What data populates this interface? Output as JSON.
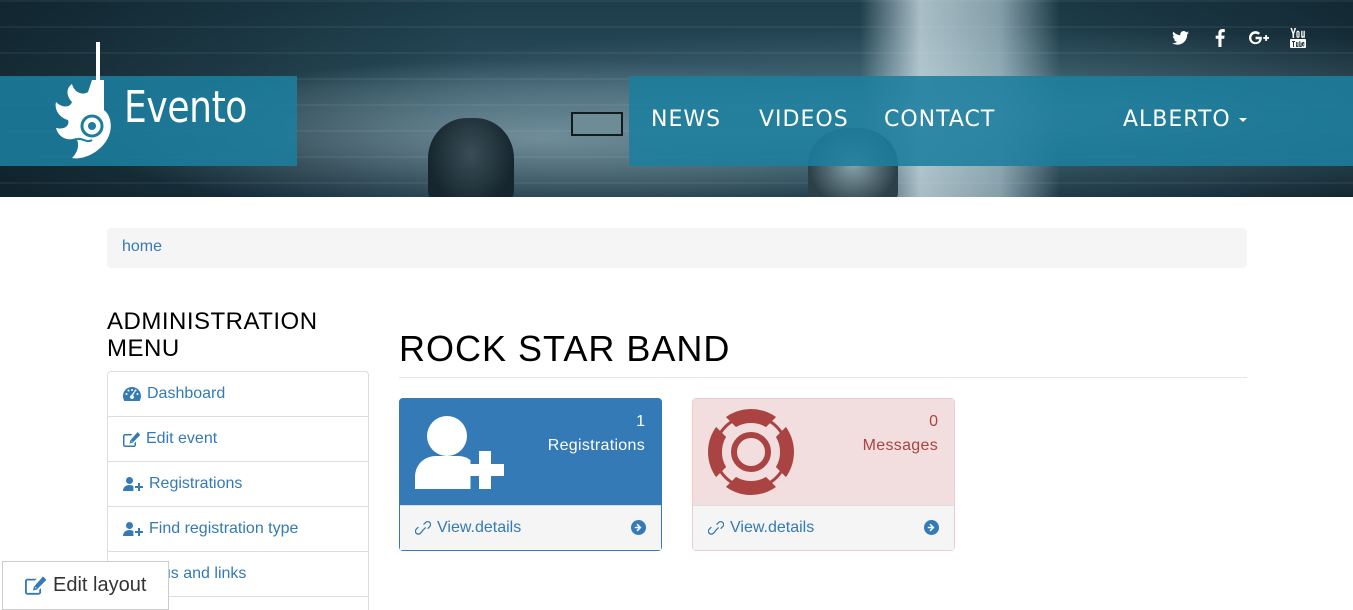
{
  "header": {
    "brand": "Evento",
    "social": [
      "twitter-icon",
      "facebook-icon",
      "google-plus-icon",
      "youtube-icon"
    ],
    "nav": [
      "NEWS",
      "VIDEOS",
      "CONTACT"
    ],
    "user_menu": "ALBERTO",
    "accent_color": "#1b7e9e"
  },
  "breadcrumb": {
    "home": "home"
  },
  "sidebar": {
    "title": "ADMINISTRATION MENU",
    "items": [
      {
        "label": "Dashboard",
        "icon": "dashboard-icon"
      },
      {
        "label": "Edit event",
        "icon": "edit-icon"
      },
      {
        "label": "Registrations",
        "icon": "user-plus-icon"
      },
      {
        "label": "Find registration type",
        "icon": "user-plus-icon"
      },
      {
        "label": "nus and links",
        "icon": ""
      }
    ]
  },
  "main": {
    "title": "ROCK STAR BAND",
    "panels": [
      {
        "count": "1",
        "label": "Registrations",
        "link": "View.details",
        "icon": "user-plus-icon",
        "color": "#337ab7"
      },
      {
        "count": "0",
        "label": "Messages",
        "link": "View.details",
        "icon": "life-ring-icon",
        "color": "#a94442"
      }
    ]
  },
  "edit_layout": {
    "label": "Edit layout"
  }
}
